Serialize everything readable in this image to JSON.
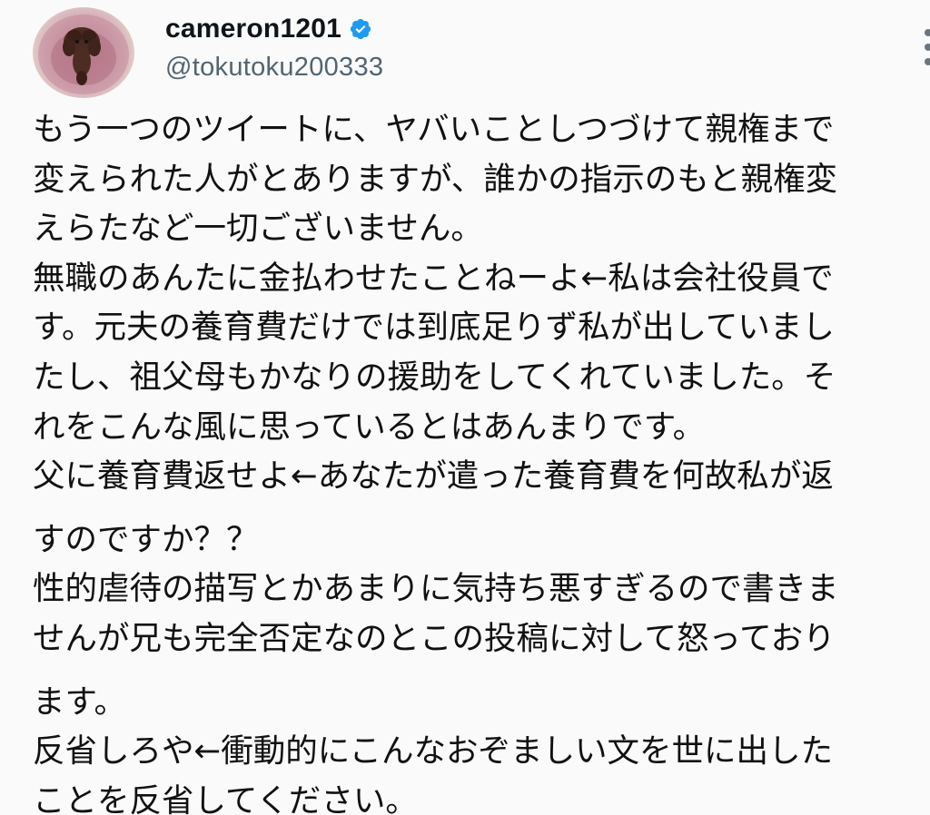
{
  "user": {
    "display_name": "cameron1201",
    "handle": "@tokutoku200333",
    "verified_icon": "verified-badge-icon"
  },
  "tweet": {
    "lines": [
      "もう一つのツイートに、ヤバいことしつづけて親権まで",
      "変えられた人がとありますが、誰かの指示のもと親権変",
      "えらたなど一切ございません。",
      "無職のあんたに金払わせたことねーよ←私は会社役員で",
      "す。元夫の養育費だけでは到底足りず私が出していまし",
      "たし、祖父母もかなりの援助をしてくれていました。そ",
      "れをこんな風に思っているとはあんまりです。",
      "父に養育費返せよ←あなたが遣った養育費を何故私が返",
      "すのですか？？",
      "性的虐待の描写とかあまりに気持ち悪すぎるので書きま",
      "せんが兄も完全否定なのとこの投稿に対して怒っており",
      "ます。",
      "反省しろや←衝動的にこんなおぞましい文を世に出した",
      "ことを反省してください。"
    ]
  },
  "colors": {
    "text": "#0f1419",
    "handle": "#536471",
    "verified": "#1d9bf0"
  }
}
